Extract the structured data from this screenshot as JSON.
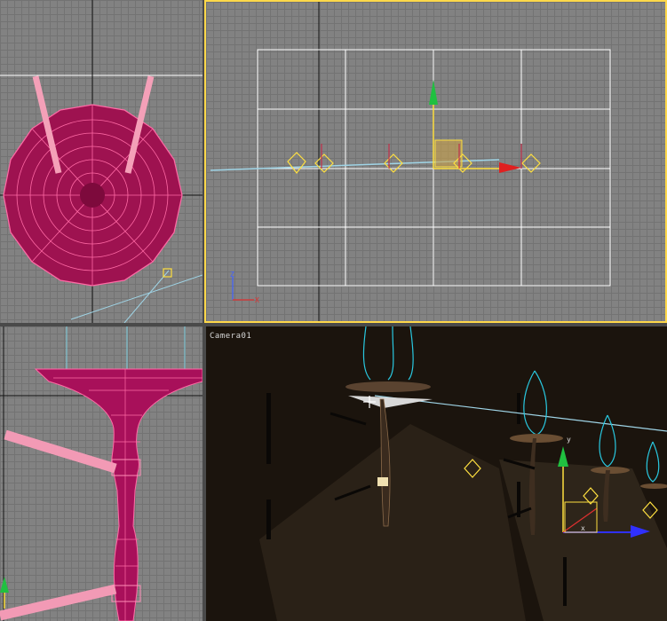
{
  "viewports": {
    "top": {
      "label": "",
      "active": false
    },
    "front": {
      "label": "",
      "active": true,
      "axis_tripod": {
        "vertical": "Z",
        "horizontal": "X"
      }
    },
    "left": {
      "label": "",
      "active": false
    },
    "camera": {
      "label": "Camera01",
      "active": false,
      "gizmo": {
        "y": "y",
        "x": "x"
      }
    }
  },
  "colors": {
    "active_border": "#ffd84a",
    "mesh": "#b0115a",
    "mesh_wire": "#ff5fa0",
    "light_helper": "#ffe040",
    "grid_major": "#ffffff",
    "camera_bg": "#1b140d"
  }
}
